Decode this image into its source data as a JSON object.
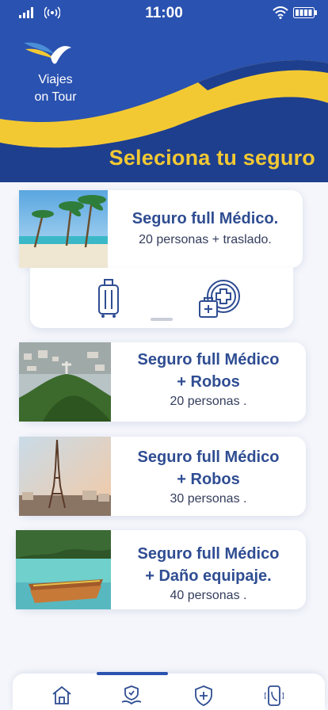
{
  "status": {
    "time": "11:00"
  },
  "brand": {
    "line1": "Viajes",
    "line2": "on Tour"
  },
  "header": {
    "title": "Seleciona tu seguro"
  },
  "colors": {
    "primary": "#2a52b0",
    "accent": "#f3c933",
    "text": "#2f4d92"
  },
  "cards": [
    {
      "title_line1": "Seguro full Médico.",
      "title_line2": "",
      "subtitle": "20 personas + traslado.",
      "image": "beach-palms"
    },
    {
      "title_line1": "Seguro full Médico",
      "title_line2": "+ Robos",
      "subtitle": "20 personas .",
      "image": "rio-christ"
    },
    {
      "title_line1": "Seguro full Médico",
      "title_line2": "+ Robos",
      "subtitle": "30 personas .",
      "image": "paris-eiffel"
    },
    {
      "title_line1": "Seguro full Médico",
      "title_line2": "+ Daño equipaje.",
      "subtitle": "40 personas .",
      "image": "boats-lake"
    }
  ],
  "expand_icons": [
    "luggage-icon",
    "medical-kit-icon"
  ],
  "tabs": [
    "home-icon",
    "hand-shield-icon",
    "shield-plus-icon",
    "phone-icon"
  ]
}
